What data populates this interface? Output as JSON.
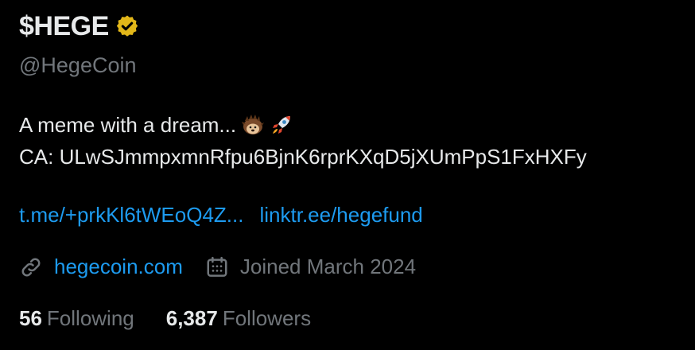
{
  "profile": {
    "display_name": "$HEGE",
    "handle": "@HegeCoin",
    "bio_line1": "A meme with a dream...",
    "bio_line2": "CA: ULwSJmmpxmnRfpu6BjnK6rprKXqD5jXUmPpS1FxHXFy",
    "links": [
      "t.me/+prkKl6tWEoQ4Z...",
      "linktr.ee/hegefund"
    ],
    "website": "hegecoin.com",
    "joined": "Joined March 2024",
    "following_count": "56",
    "following_label": "Following",
    "followers_count": "6,387",
    "followers_label": "Followers"
  },
  "icons": {
    "verified": "verified-badge-icon",
    "emoji1": "hedgehog-emoji",
    "emoji2": "rocket-emoji",
    "website": "link-icon",
    "joined": "calendar-icon"
  },
  "colors": {
    "background": "#000000",
    "primary_text": "#e7e9ea",
    "secondary_text": "#71767b",
    "link": "#1d9bf0",
    "verified_gold": "#e2b719"
  }
}
